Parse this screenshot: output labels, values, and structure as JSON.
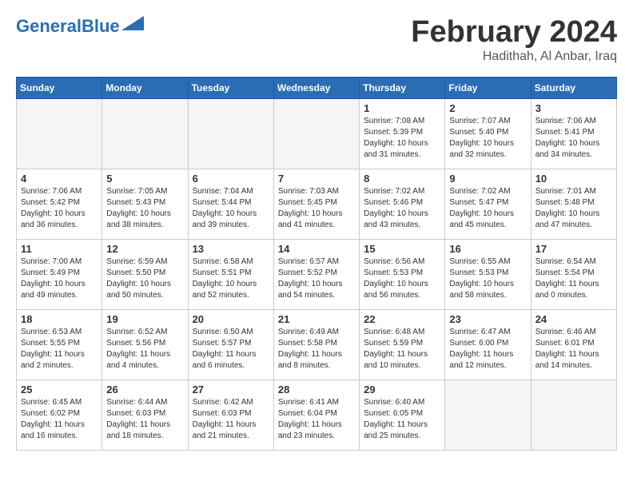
{
  "header": {
    "logo_general": "General",
    "logo_blue": "Blue",
    "title": "February 2024",
    "subtitle": "Hadithah, Al Anbar, Iraq"
  },
  "weekdays": [
    "Sunday",
    "Monday",
    "Tuesday",
    "Wednesday",
    "Thursday",
    "Friday",
    "Saturday"
  ],
  "weeks": [
    [
      {
        "day": "",
        "info": ""
      },
      {
        "day": "",
        "info": ""
      },
      {
        "day": "",
        "info": ""
      },
      {
        "day": "",
        "info": ""
      },
      {
        "day": "1",
        "info": "Sunrise: 7:08 AM\nSunset: 5:39 PM\nDaylight: 10 hours\nand 31 minutes."
      },
      {
        "day": "2",
        "info": "Sunrise: 7:07 AM\nSunset: 5:40 PM\nDaylight: 10 hours\nand 32 minutes."
      },
      {
        "day": "3",
        "info": "Sunrise: 7:06 AM\nSunset: 5:41 PM\nDaylight: 10 hours\nand 34 minutes."
      }
    ],
    [
      {
        "day": "4",
        "info": "Sunrise: 7:06 AM\nSunset: 5:42 PM\nDaylight: 10 hours\nand 36 minutes."
      },
      {
        "day": "5",
        "info": "Sunrise: 7:05 AM\nSunset: 5:43 PM\nDaylight: 10 hours\nand 38 minutes."
      },
      {
        "day": "6",
        "info": "Sunrise: 7:04 AM\nSunset: 5:44 PM\nDaylight: 10 hours\nand 39 minutes."
      },
      {
        "day": "7",
        "info": "Sunrise: 7:03 AM\nSunset: 5:45 PM\nDaylight: 10 hours\nand 41 minutes."
      },
      {
        "day": "8",
        "info": "Sunrise: 7:02 AM\nSunset: 5:46 PM\nDaylight: 10 hours\nand 43 minutes."
      },
      {
        "day": "9",
        "info": "Sunrise: 7:02 AM\nSunset: 5:47 PM\nDaylight: 10 hours\nand 45 minutes."
      },
      {
        "day": "10",
        "info": "Sunrise: 7:01 AM\nSunset: 5:48 PM\nDaylight: 10 hours\nand 47 minutes."
      }
    ],
    [
      {
        "day": "11",
        "info": "Sunrise: 7:00 AM\nSunset: 5:49 PM\nDaylight: 10 hours\nand 49 minutes."
      },
      {
        "day": "12",
        "info": "Sunrise: 6:59 AM\nSunset: 5:50 PM\nDaylight: 10 hours\nand 50 minutes."
      },
      {
        "day": "13",
        "info": "Sunrise: 6:58 AM\nSunset: 5:51 PM\nDaylight: 10 hours\nand 52 minutes."
      },
      {
        "day": "14",
        "info": "Sunrise: 6:57 AM\nSunset: 5:52 PM\nDaylight: 10 hours\nand 54 minutes."
      },
      {
        "day": "15",
        "info": "Sunrise: 6:56 AM\nSunset: 5:53 PM\nDaylight: 10 hours\nand 56 minutes."
      },
      {
        "day": "16",
        "info": "Sunrise: 6:55 AM\nSunset: 5:53 PM\nDaylight: 10 hours\nand 58 minutes."
      },
      {
        "day": "17",
        "info": "Sunrise: 6:54 AM\nSunset: 5:54 PM\nDaylight: 11 hours\nand 0 minutes."
      }
    ],
    [
      {
        "day": "18",
        "info": "Sunrise: 6:53 AM\nSunset: 5:55 PM\nDaylight: 11 hours\nand 2 minutes."
      },
      {
        "day": "19",
        "info": "Sunrise: 6:52 AM\nSunset: 5:56 PM\nDaylight: 11 hours\nand 4 minutes."
      },
      {
        "day": "20",
        "info": "Sunrise: 6:50 AM\nSunset: 5:57 PM\nDaylight: 11 hours\nand 6 minutes."
      },
      {
        "day": "21",
        "info": "Sunrise: 6:49 AM\nSunset: 5:58 PM\nDaylight: 11 hours\nand 8 minutes."
      },
      {
        "day": "22",
        "info": "Sunrise: 6:48 AM\nSunset: 5:59 PM\nDaylight: 11 hours\nand 10 minutes."
      },
      {
        "day": "23",
        "info": "Sunrise: 6:47 AM\nSunset: 6:00 PM\nDaylight: 11 hours\nand 12 minutes."
      },
      {
        "day": "24",
        "info": "Sunrise: 6:46 AM\nSunset: 6:01 PM\nDaylight: 11 hours\nand 14 minutes."
      }
    ],
    [
      {
        "day": "25",
        "info": "Sunrise: 6:45 AM\nSunset: 6:02 PM\nDaylight: 11 hours\nand 16 minutes."
      },
      {
        "day": "26",
        "info": "Sunrise: 6:44 AM\nSunset: 6:03 PM\nDaylight: 11 hours\nand 18 minutes."
      },
      {
        "day": "27",
        "info": "Sunrise: 6:42 AM\nSunset: 6:03 PM\nDaylight: 11 hours\nand 21 minutes."
      },
      {
        "day": "28",
        "info": "Sunrise: 6:41 AM\nSunset: 6:04 PM\nDaylight: 11 hours\nand 23 minutes."
      },
      {
        "day": "29",
        "info": "Sunrise: 6:40 AM\nSunset: 6:05 PM\nDaylight: 11 hours\nand 25 minutes."
      },
      {
        "day": "",
        "info": ""
      },
      {
        "day": "",
        "info": ""
      }
    ]
  ]
}
